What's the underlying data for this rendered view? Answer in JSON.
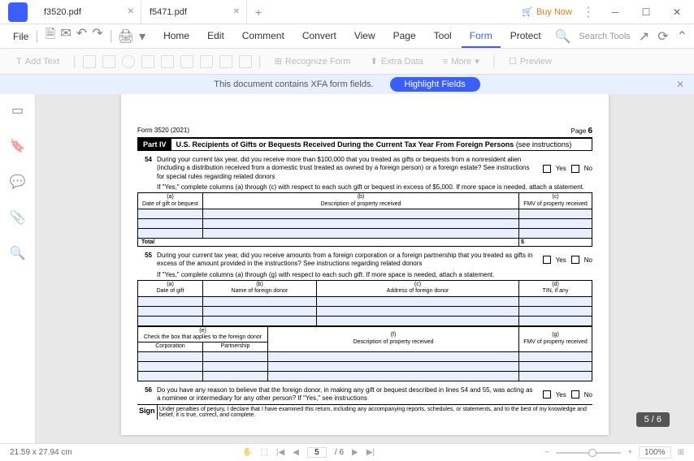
{
  "tabs": [
    {
      "name": "f3520.pdf",
      "active": true
    },
    {
      "name": "f5471.pdf",
      "active": false
    }
  ],
  "buy_now": "Buy Now",
  "file_menu": "File",
  "menu": {
    "home": "Home",
    "edit": "Edit",
    "comment": "Comment",
    "convert": "Convert",
    "view": "View",
    "page": "Page",
    "tool": "Tool",
    "form": "Form",
    "protect": "Protect"
  },
  "search_tools": "Search Tools",
  "toolbar": {
    "add_text": "Add Text",
    "recognize": "Recognize Form",
    "extra_data": "Extra Data",
    "more": "More",
    "preview": "Preview"
  },
  "banner": {
    "msg": "This document contains XFA form fields.",
    "btn": "Highlight Fields"
  },
  "form": {
    "form_no": "Form 3520 (2021)",
    "page_label": "Page",
    "page_no": "6",
    "part": "Part IV",
    "part_title": "U.S. Recipients of Gifts or Bequests Received During the Current Tax Year From Foreign Persons",
    "see": "(see instructions)",
    "q54": {
      "num": "54",
      "text": "During your current tax year, did you receive more than $100,000 that you treated as gifts or bequests from a nonresident alien (including a distribution received from a domestic trust treated as owned by a foreign person) or a foreign estate? See instructions for special rules regarding related donors",
      "instr": "If \"Yes,\" complete columns (a) through (c) with respect to each such gift or bequest in excess of $5,000. If more space is needed, attach a statement."
    },
    "yes": "Yes",
    "no": "No",
    "t54": {
      "a": "(a)",
      "a2": "Date of gift or bequest",
      "b": "(b)",
      "b2": "Description of property received",
      "c": "(c)",
      "c2": "FMV of property received",
      "total": "Total",
      "dollar": "$"
    },
    "q55": {
      "num": "55",
      "text": "During your current tax year, did you receive amounts from a foreign corporation or a foreign partnership that you treated as gifts in excess of the amount provided in the instructions? See instructions regarding related donors",
      "instr": "If \"Yes,\" complete columns (a) through (g) with respect to each such gift. If more space is needed, attach a statement."
    },
    "t55a": {
      "a": "(a)",
      "a2": "Date of gift",
      "b": "(b)",
      "b2": "Name of foreign donor",
      "c": "(c)",
      "c2": "Address of foreign donor",
      "d": "(d)",
      "d2": "TIN, if any"
    },
    "t55b": {
      "e": "(e)",
      "e2": "Check the box that applies to the foreign donor",
      "corp": "Corporation",
      "part": "Partnership",
      "f": "(f)",
      "f2": "Description of property received",
      "g": "(g)",
      "g2": "FMV of property received"
    },
    "q56": {
      "num": "56",
      "text": "Do you have any reason to believe that the foreign donor, in making any gift or bequest described in lines 54 and 55, was acting as a nominee or intermediary for any other person? If \"Yes,\" see instructions"
    },
    "sign": "Sign",
    "perjury": "Under penalties of perjury, I declare that I have examined this return, including any accompanying reports, schedules, or statements, and to the best of my knowledge and belief, it is true, correct, and complete."
  },
  "page_badge": "5 / 6",
  "status": {
    "dims": "21.59 x 27.94 cm",
    "page_cur": "5",
    "page_total": "/ 6",
    "zoom": "100%"
  }
}
